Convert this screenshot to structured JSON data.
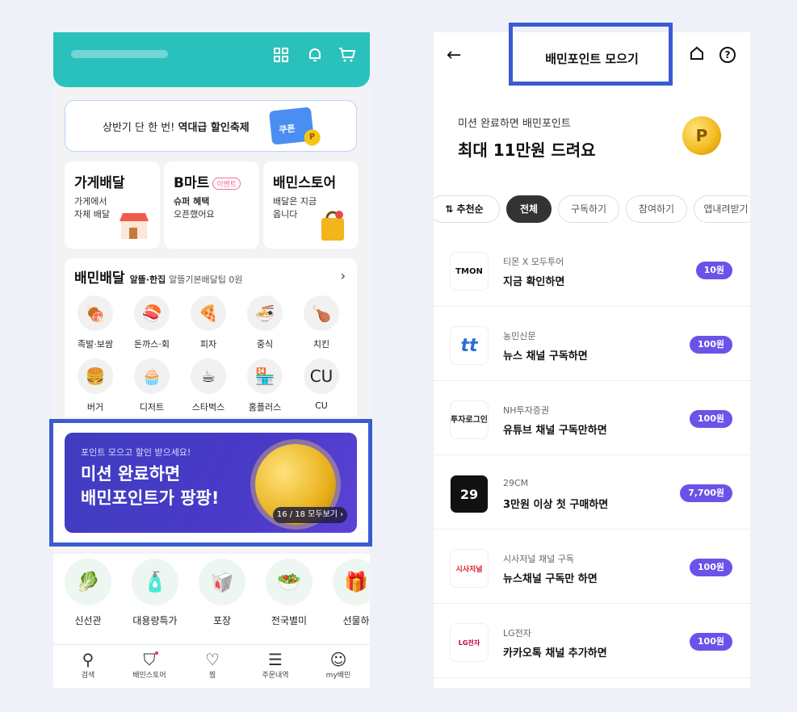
{
  "left_screen": {
    "header_icons": [
      "grid-icon",
      "bell-icon",
      "cart-icon"
    ],
    "promo": {
      "text_prefix": "상반기 단 한 번! ",
      "text_bold": "역대급 할인축제",
      "coupon_label": "쿠폰"
    },
    "tiles": [
      {
        "title": "가게배달",
        "sub1": "가게에서",
        "sub2": "자체 배달"
      },
      {
        "title": "B마트",
        "badge": "이벤트",
        "sub1": "슈퍼 혜택",
        "sub2": "오픈했어요"
      },
      {
        "title": "배민스토어",
        "sub1": "배달은 지금",
        "sub2": "옵니다"
      }
    ],
    "baemin": {
      "title": "배민배달",
      "tagline_bold": "알뜰·한집",
      "tagline": "알뜰기본배달팁 0원",
      "categories": [
        {
          "label": "족발·보쌈",
          "icon": "🍖"
        },
        {
          "label": "돈까스·회",
          "icon": "🍣"
        },
        {
          "label": "피자",
          "icon": "🍕"
        },
        {
          "label": "중식",
          "icon": "🍜"
        },
        {
          "label": "치킨",
          "icon": "🍗"
        },
        {
          "label": "버거",
          "icon": "🍔"
        },
        {
          "label": "디저트",
          "icon": "🧁"
        },
        {
          "label": "스타벅스",
          "icon": "☕"
        },
        {
          "label": "홈플러스",
          "icon": "🏪"
        },
        {
          "label": "CU",
          "icon": "CU"
        }
      ]
    },
    "banner": {
      "small": "포인트 모으고 할인 받으세요!",
      "line1": "미션 완료하면",
      "line2": "배민포인트가 팡팡!",
      "pager": "16 / 18  모두보기 ›"
    },
    "shop": [
      {
        "label": "신선관",
        "icon": "🥬"
      },
      {
        "label": "대용량특가",
        "icon": "🧴"
      },
      {
        "label": "포장",
        "icon": "🥡"
      },
      {
        "label": "전국별미",
        "icon": "🥗"
      },
      {
        "label": "선물하",
        "icon": "🎁"
      }
    ],
    "tabs": [
      {
        "label": "검색",
        "icon": "search-icon"
      },
      {
        "label": "배민스토어",
        "icon": "bag-icon"
      },
      {
        "label": "찜",
        "icon": "heart-icon"
      },
      {
        "label": "주문내역",
        "icon": "receipt-icon"
      },
      {
        "label": "my배민",
        "icon": "smile-icon"
      }
    ]
  },
  "right_screen": {
    "title": "배민포인트 모으기",
    "hero_sub": "미션 완료하면 배민포인트",
    "hero_main": "최대 11만원 드려요",
    "coin_label": "P",
    "chips": [
      "⇅ 추천순",
      "전체",
      "구독하기",
      "참여하기",
      "앱내려받기"
    ],
    "missions": [
      {
        "logo": "TMON",
        "brand": "티몬 X 모두투어",
        "mission": "지금 확인하면",
        "reward": "10원"
      },
      {
        "logo": "tt",
        "brand": "농민신문",
        "mission": "뉴스 채널 구독하면",
        "reward": "100원"
      },
      {
        "logo": "투자로그인",
        "brand": "NH투자증권",
        "mission": "유튜브 채널 구독만하면",
        "reward": "100원"
      },
      {
        "logo": "29",
        "brand": "29CM",
        "mission": "3만원 이상 첫 구매하면",
        "reward": "7,700원"
      },
      {
        "logo": "시사저널",
        "brand": "시사저널 채널 구독",
        "mission": "뉴스채널 구독만 하면",
        "reward": "100원"
      },
      {
        "logo": "LG전자",
        "brand": "LG전자",
        "mission": "카카오톡 채널 추가하면",
        "reward": "100원"
      }
    ]
  },
  "colors": {
    "mint": "#2ac1bc",
    "purple_badge": "#6b52e8",
    "highlight": "#3b5bd0"
  }
}
